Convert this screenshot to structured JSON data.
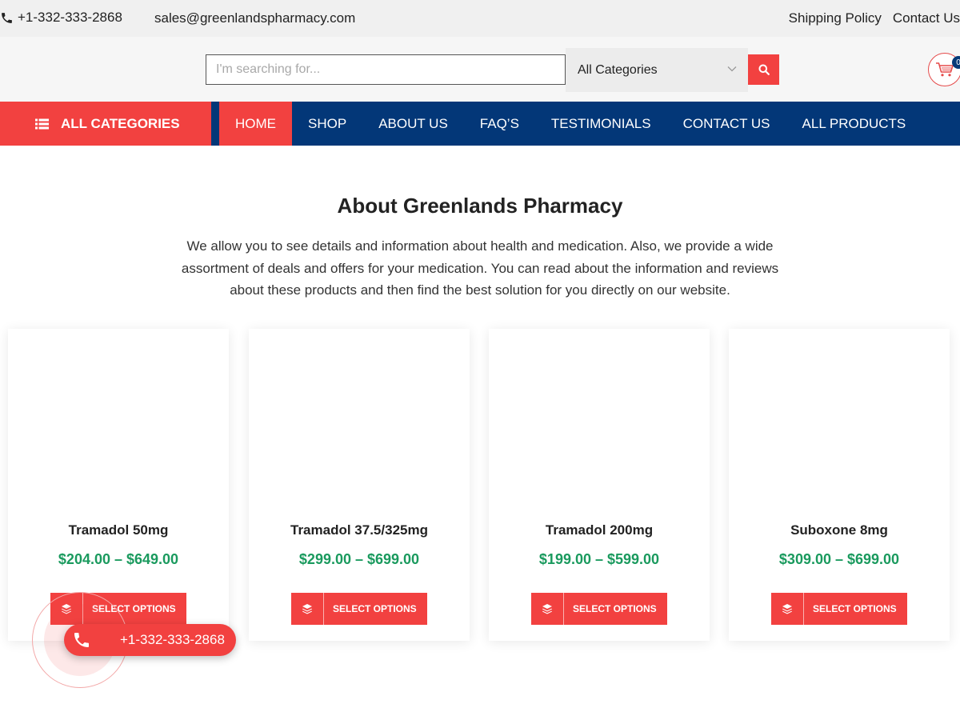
{
  "topbar": {
    "phone": "+1-332-333-2868",
    "email": "sales@greenlandspharmacy.com",
    "links": [
      "Shipping Policy",
      "Contact Us"
    ]
  },
  "search": {
    "placeholder": "I'm searching for...",
    "category": "All Categories"
  },
  "cart": {
    "count": "0"
  },
  "nav": {
    "all_categories": "ALL CATEGORIES",
    "items": [
      "HOME",
      "SHOP",
      "ABOUT US",
      "FAQ’S",
      "TESTIMONIALS",
      "CONTACT US",
      "ALL PRODUCTS"
    ],
    "active": "HOME"
  },
  "about": {
    "title": "About Greenlands Pharmacy",
    "text": "We allow you to see details and information about health and medication. Also, we provide a wide assortment of deals and offers for your medication. You can read about the information and reviews about these products and then find the best solution for you directly on our website."
  },
  "products": [
    {
      "name": "Tramadol 50mg",
      "price": "$204.00 – $649.00",
      "button": "SELECT OPTIONS"
    },
    {
      "name": "Tramadol 37.5/325mg",
      "price": "$299.00 – $699.00",
      "button": "SELECT OPTIONS"
    },
    {
      "name": "Tramadol 200mg",
      "price": "$199.00 – $599.00",
      "button": "SELECT OPTIONS"
    },
    {
      "name": "Suboxone 8mg",
      "price": "$309.00 – $699.00",
      "button": "SELECT OPTIONS"
    }
  ],
  "floating_call": {
    "number": "+1-332-333-2868"
  },
  "colors": {
    "accent": "#f24140",
    "nav_bg": "#033778",
    "price": "#1a9a5e",
    "topbar_bg": "#f0f0f0"
  },
  "icons": [
    "phone-icon",
    "chevron-down-icon",
    "search-icon",
    "cart-icon",
    "list-icon",
    "layers-icon"
  ]
}
